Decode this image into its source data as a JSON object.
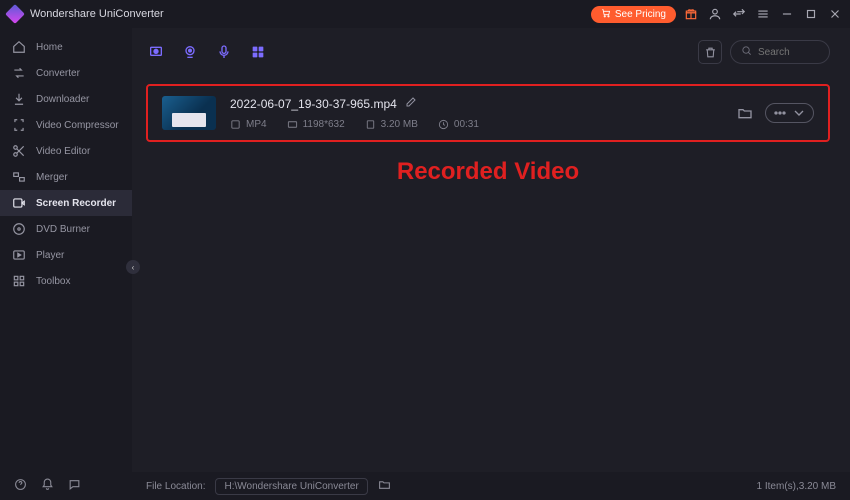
{
  "app_title": "Wondershare UniConverter",
  "pricing_label": "See Pricing",
  "search": {
    "placeholder": "Search"
  },
  "annotation": "Recorded Video",
  "sidebar": {
    "items": [
      {
        "label": "Home"
      },
      {
        "label": "Converter"
      },
      {
        "label": "Downloader"
      },
      {
        "label": "Video Compressor"
      },
      {
        "label": "Video Editor"
      },
      {
        "label": "Merger"
      },
      {
        "label": "Screen Recorder"
      },
      {
        "label": "DVD Burner"
      },
      {
        "label": "Player"
      },
      {
        "label": "Toolbox"
      }
    ],
    "active_index": 6
  },
  "recording": {
    "filename": "2022-06-07_19-30-37-965.mp4",
    "format": "MP4",
    "resolution": "1198*632",
    "size": "3.20 MB",
    "duration": "00:31"
  },
  "footer": {
    "location_label": "File Location:",
    "location_path": "H:\\Wondershare UniConverter",
    "summary": "1 Item(s),3.20 MB"
  }
}
